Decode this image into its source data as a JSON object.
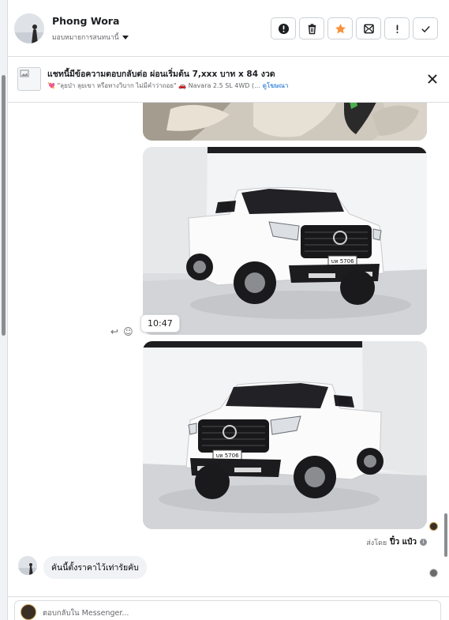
{
  "contact": {
    "name": "Phong Wora",
    "assign_label": "มอบหมายการสนทนานี้"
  },
  "toolbar": {
    "buttons": [
      {
        "icon": "alert-circle-icon",
        "tooltip": "spam"
      },
      {
        "icon": "trash-icon",
        "tooltip": "delete"
      },
      {
        "icon": "star-icon",
        "tooltip": "follow up"
      },
      {
        "icon": "mark-unread-icon",
        "tooltip": "mark unread"
      },
      {
        "icon": "exclamation-icon",
        "tooltip": "important"
      },
      {
        "icon": "checkmark-icon",
        "tooltip": "done"
      }
    ],
    "star_color": "#f7923a"
  },
  "ad_banner": {
    "title": "แชทนี้มีข้อความตอบกลับต่อ ผ่อนเริ่มต้น 7,xxx บาท x 84 งวด",
    "subtitle": "💘 \"ลุยป่า ลุยเขา หรือทางวิบาก ไม่มีคำว่าถอย\" 🚗 Navara 2.5 SL 4WD (...",
    "link_label": "ดูโฆษณา"
  },
  "messages": {
    "photo_timestamp": "10:47",
    "reply_icon": "reply-icon",
    "react_icon": "smiley-icon",
    "sent_by_prefix": "ส่งโดย",
    "sent_by_name": "ปิ๋ว แป๋ว",
    "incoming_text": "คันนี้ตั้งราคาไว้เท่ารัยคับ",
    "plate_text": "บห 5706"
  },
  "composer": {
    "placeholder": "ตอบกลับใน Messenger..."
  },
  "colors": {
    "link": "#0064d1",
    "border": "#dadde1",
    "bubble": "#f0f2f5"
  }
}
